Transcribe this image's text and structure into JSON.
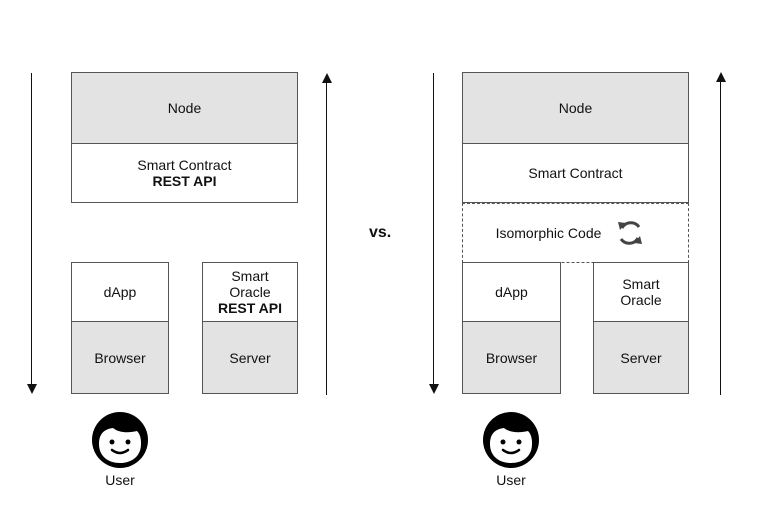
{
  "separator_label": "vs.",
  "left_diagram": {
    "node": "Node",
    "smart_contract": {
      "line1": "Smart Contract",
      "line2": "REST API"
    },
    "dapp": "dApp",
    "browser": "Browser",
    "smart_oracle": {
      "line1": "Smart",
      "line2": "Oracle",
      "line3": "REST API"
    },
    "server": "Server",
    "user_label": "User"
  },
  "right_diagram": {
    "node": "Node",
    "smart_contract": "Smart Contract",
    "isomorphic_code": "Isomorphic Code",
    "dapp": "dApp",
    "browser": "Browser",
    "smart_oracle": {
      "line1": "Smart",
      "line2": "Oracle"
    },
    "server": "Server",
    "user_label": "User"
  },
  "icons": {
    "sync": "sync-icon",
    "user": "user-avatar-icon",
    "arrow_down": "arrow-down-icon",
    "arrow_up": "arrow-up-icon"
  }
}
